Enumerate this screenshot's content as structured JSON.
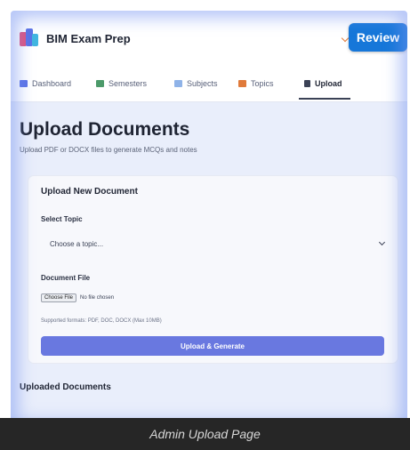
{
  "app": {
    "name": "BIM Exam Prep",
    "review_label": "Review"
  },
  "nav": {
    "items": [
      {
        "label": "Dashboard",
        "icon": "dashboard-icon"
      },
      {
        "label": "Semesters",
        "icon": "semesters-icon"
      },
      {
        "label": "Subjects",
        "icon": "subjects-icon"
      },
      {
        "label": "Topics",
        "icon": "topics-icon"
      },
      {
        "label": "Upload",
        "icon": "upload-icon"
      }
    ],
    "active": "Upload"
  },
  "page": {
    "title": "Upload Documents",
    "subtitle": "Upload PDF or DOCX files to generate MCQs and notes"
  },
  "form": {
    "card_title": "Upload New Document",
    "topic_label": "Select Topic",
    "topic_value": "Choose a topic...",
    "file_label": "Document File",
    "choose_file_label": "Choose File",
    "file_status": "No file chosen",
    "hint": "Supported formats: PDF, DOC, DOCX (Max 10MB)",
    "submit_label": "Upload & Generate"
  },
  "uploaded": {
    "title": "Uploaded Documents"
  },
  "caption": "Admin Upload Page",
  "colors": {
    "accent": "#1677d9",
    "submit": "#6978e0",
    "glow": "#7896f0"
  }
}
